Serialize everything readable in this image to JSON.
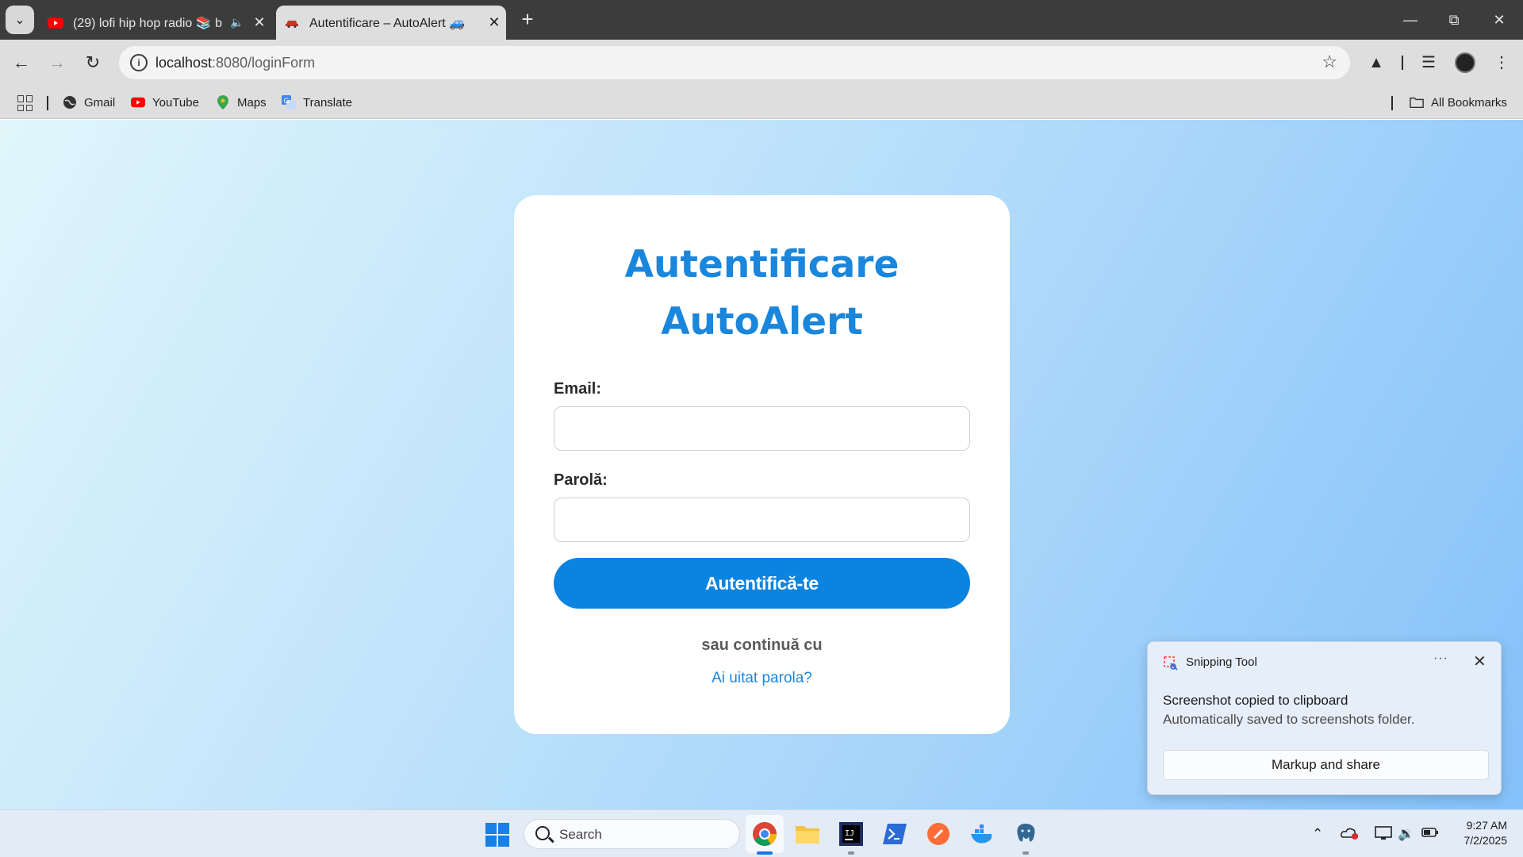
{
  "browser": {
    "tabs": [
      {
        "title": "(29) lofi hip hop radio 📚 b",
        "favicon": "youtube-icon",
        "playing_audio": true,
        "active": false
      },
      {
        "title": "Autentificare – AutoAlert 🚙",
        "favicon": "car-icon",
        "active": true
      }
    ],
    "address_bar": {
      "host": "localhost",
      "path": ":8080/loginForm"
    },
    "bookmarks": [
      {
        "label": "Gmail",
        "icon": "globe-icon"
      },
      {
        "label": "YouTube",
        "icon": "youtube-icon"
      },
      {
        "label": "Maps",
        "icon": "maps-pin-icon"
      },
      {
        "label": "Translate",
        "icon": "translate-icon"
      }
    ],
    "all_bookmarks_label": "All Bookmarks"
  },
  "page": {
    "title_line1": "Autentificare",
    "title_line2": "AutoAlert",
    "email_label": "Email:",
    "email_value": "",
    "password_label": "Parolă:",
    "password_value": "",
    "submit_label": "Autentifică-te",
    "alternative_text": "sau continuă cu",
    "forgot_password_link": "Ai uitat parola?"
  },
  "toast": {
    "app_name": "Snipping Tool",
    "more_label": "···",
    "heading": "Screenshot copied to clipboard",
    "subtext": "Automatically saved to screenshots folder.",
    "button_label": "Markup and share"
  },
  "taskbar": {
    "search_placeholder": "Search",
    "time": "9:27 AM",
    "date": "7/2/2025"
  },
  "colors": {
    "accent": "#1a86dc",
    "button": "#0b83e0",
    "background_start": "#e0f6fb",
    "background_end": "#84c1f9"
  }
}
